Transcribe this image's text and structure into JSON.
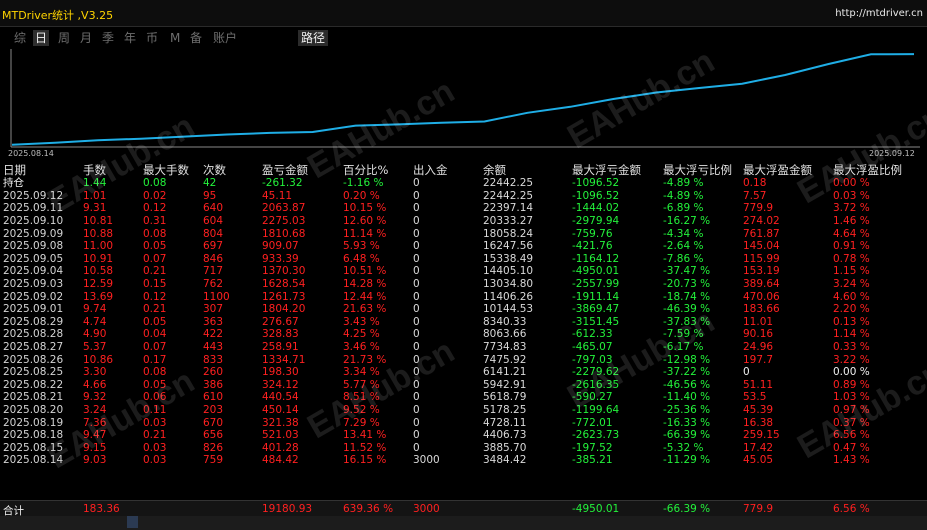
{
  "app": {
    "title": "MTDriver统计 ,V3.25",
    "url": "http://mtdriver.cn"
  },
  "tabs": [
    "综",
    "日",
    "周",
    "月",
    "季",
    "年",
    "币",
    "M",
    "备",
    "账户"
  ],
  "active_tab": "日",
  "path_button": "路径",
  "chart": {
    "start_date": "2025.08.14",
    "end_date": "2025.09.12",
    "line_color": "#1faee6",
    "balance_series": [
      3484.42,
      3885.7,
      4406.73,
      4728.11,
      5178.25,
      5618.79,
      5942.91,
      6141.21,
      7475.92,
      7734.83,
      8063.66,
      8340.33,
      10144.53,
      11406.26,
      13034.8,
      14405.1,
      15338.49,
      16247.56,
      18058.24,
      20333.27,
      22397.14,
      22442.25
    ]
  },
  "columns": [
    "日期",
    "手数",
    "最大手数",
    "次数",
    "盈亏金额",
    "百分比%",
    "出入金",
    "余额",
    "最大浮亏金额",
    "最大浮亏比例",
    "最大浮盈金额",
    "最大浮盈比例"
  ],
  "position_row": {
    "date": "持仓",
    "lots": "1.44",
    "max_lots": "0.08",
    "count": "42",
    "pl": "-261.32",
    "pct": "-1.16 %",
    "io": "0",
    "balance": "22442.25",
    "max_loss": "-1096.52",
    "max_loss_pct": "-4.89 %",
    "max_gain": "0.18",
    "max_gain_pct": "0.00 %"
  },
  "rows": [
    {
      "date": "2025.09.12",
      "lots": "1.01",
      "max_lots": "0.02",
      "count": "95",
      "pl": "45.11",
      "pct": "0.20 %",
      "io": "0",
      "balance": "22442.25",
      "max_loss": "-1096.52",
      "max_loss_pct": "-4.89 %",
      "max_gain": "7.57",
      "max_gain_pct": "0.03 %"
    },
    {
      "date": "2025.09.11",
      "lots": "9.31",
      "max_lots": "0.12",
      "count": "640",
      "pl": "2063.87",
      "pct": "10.15 %",
      "io": "0",
      "balance": "22397.14",
      "max_loss": "-1444.02",
      "max_loss_pct": "-6.89 %",
      "max_gain": "779.9",
      "max_gain_pct": "3.72 %"
    },
    {
      "date": "2025.09.10",
      "lots": "10.81",
      "max_lots": "0.31",
      "count": "604",
      "pl": "2275.03",
      "pct": "12.60 %",
      "io": "0",
      "balance": "20333.27",
      "max_loss": "-2979.94",
      "max_loss_pct": "-16.27 %",
      "max_gain": "274.02",
      "max_gain_pct": "1.46 %"
    },
    {
      "date": "2025.09.09",
      "lots": "10.88",
      "max_lots": "0.08",
      "count": "804",
      "pl": "1810.68",
      "pct": "11.14 %",
      "io": "0",
      "balance": "18058.24",
      "max_loss": "-759.76",
      "max_loss_pct": "-4.34 %",
      "max_gain": "761.87",
      "max_gain_pct": "4.64 %"
    },
    {
      "date": "2025.09.08",
      "lots": "11.00",
      "max_lots": "0.05",
      "count": "697",
      "pl": "909.07",
      "pct": "5.93 %",
      "io": "0",
      "balance": "16247.56",
      "max_loss": "-421.76",
      "max_loss_pct": "-2.64 %",
      "max_gain": "145.04",
      "max_gain_pct": "0.91 %"
    },
    {
      "date": "2025.09.05",
      "lots": "10.91",
      "max_lots": "0.07",
      "count": "846",
      "pl": "933.39",
      "pct": "6.48 %",
      "io": "0",
      "balance": "15338.49",
      "max_loss": "-1164.12",
      "max_loss_pct": "-7.86 %",
      "max_gain": "115.99",
      "max_gain_pct": "0.78 %"
    },
    {
      "date": "2025.09.04",
      "lots": "10.58",
      "max_lots": "0.21",
      "count": "717",
      "pl": "1370.30",
      "pct": "10.51 %",
      "io": "0",
      "balance": "14405.10",
      "max_loss": "-4950.01",
      "max_loss_pct": "-37.47 %",
      "max_gain": "153.19",
      "max_gain_pct": "1.15 %"
    },
    {
      "date": "2025.09.03",
      "lots": "12.59",
      "max_lots": "0.15",
      "count": "762",
      "pl": "1628.54",
      "pct": "14.28 %",
      "io": "0",
      "balance": "13034.80",
      "max_loss": "-2557.99",
      "max_loss_pct": "-20.73 %",
      "max_gain": "389.64",
      "max_gain_pct": "3.24 %"
    },
    {
      "date": "2025.09.02",
      "lots": "13.69",
      "max_lots": "0.12",
      "count": "1100",
      "pl": "1261.73",
      "pct": "12.44 %",
      "io": "0",
      "balance": "11406.26",
      "max_loss": "-1911.14",
      "max_loss_pct": "-18.74 %",
      "max_gain": "470.06",
      "max_gain_pct": "4.60 %"
    },
    {
      "date": "2025.09.01",
      "lots": "9.74",
      "max_lots": "0.21",
      "count": "307",
      "pl": "1804.20",
      "pct": "21.63 %",
      "io": "0",
      "balance": "10144.53",
      "max_loss": "-3869.47",
      "max_loss_pct": "-46.39 %",
      "max_gain": "183.66",
      "max_gain_pct": "2.20 %"
    },
    {
      "date": "2025.08.29",
      "lots": "4.74",
      "max_lots": "0.05",
      "count": "363",
      "pl": "276.67",
      "pct": "3.43 %",
      "io": "0",
      "balance": "8340.33",
      "max_loss": "-3151.45",
      "max_loss_pct": "-37.83 %",
      "max_gain": "11.01",
      "max_gain_pct": "0.13 %"
    },
    {
      "date": "2025.08.28",
      "lots": "4.90",
      "max_lots": "0.04",
      "count": "422",
      "pl": "328.83",
      "pct": "4.25 %",
      "io": "0",
      "balance": "8063.66",
      "max_loss": "-612.33",
      "max_loss_pct": "-7.59 %",
      "max_gain": "90.16",
      "max_gain_pct": "1.14 %"
    },
    {
      "date": "2025.08.27",
      "lots": "5.37",
      "max_lots": "0.07",
      "count": "443",
      "pl": "258.91",
      "pct": "3.46 %",
      "io": "0",
      "balance": "7734.83",
      "max_loss": "-465.07",
      "max_loss_pct": "-6.17 %",
      "max_gain": "24.96",
      "max_gain_pct": "0.33 %"
    },
    {
      "date": "2025.08.26",
      "lots": "10.86",
      "max_lots": "0.17",
      "count": "833",
      "pl": "1334.71",
      "pct": "21.73 %",
      "io": "0",
      "balance": "7475.92",
      "max_loss": "-797.03",
      "max_loss_pct": "-12.98 %",
      "max_gain": "197.7",
      "max_gain_pct": "3.22 %"
    },
    {
      "date": "2025.08.25",
      "lots": "3.30",
      "max_lots": "0.08",
      "count": "260",
      "pl": "198.30",
      "pct": "3.34 %",
      "io": "0",
      "balance": "6141.21",
      "max_loss": "-2279.62",
      "max_loss_pct": "-37.22 %",
      "max_gain": "0",
      "max_gain_pct": "0.00 %"
    },
    {
      "date": "2025.08.22",
      "lots": "4.66",
      "max_lots": "0.05",
      "count": "386",
      "pl": "324.12",
      "pct": "5.77 %",
      "io": "0",
      "balance": "5942.91",
      "max_loss": "-2616.35",
      "max_loss_pct": "-46.56 %",
      "max_gain": "51.11",
      "max_gain_pct": "0.89 %"
    },
    {
      "date": "2025.08.21",
      "lots": "9.32",
      "max_lots": "0.06",
      "count": "610",
      "pl": "440.54",
      "pct": "8.51 %",
      "io": "0",
      "balance": "5618.79",
      "max_loss": "-590.27",
      "max_loss_pct": "-11.40 %",
      "max_gain": "53.5",
      "max_gain_pct": "1.03 %"
    },
    {
      "date": "2025.08.20",
      "lots": "3.24",
      "max_lots": "0.11",
      "count": "203",
      "pl": "450.14",
      "pct": "9.52 %",
      "io": "0",
      "balance": "5178.25",
      "max_loss": "-1199.64",
      "max_loss_pct": "-25.36 %",
      "max_gain": "45.39",
      "max_gain_pct": "0.97 %"
    },
    {
      "date": "2025.08.19",
      "lots": "7.36",
      "max_lots": "0.03",
      "count": "670",
      "pl": "321.38",
      "pct": "7.29 %",
      "io": "0",
      "balance": "4728.11",
      "max_loss": "-772.01",
      "max_loss_pct": "-16.33 %",
      "max_gain": "16.38",
      "max_gain_pct": "0.37 %"
    },
    {
      "date": "2025.08.18",
      "lots": "9.47",
      "max_lots": "0.21",
      "count": "656",
      "pl": "521.03",
      "pct": "13.41 %",
      "io": "0",
      "balance": "4406.73",
      "max_loss": "-2623.73",
      "max_loss_pct": "-66.39 %",
      "max_gain": "259.15",
      "max_gain_pct": "6.56 %"
    },
    {
      "date": "2025.08.15",
      "lots": "9.15",
      "max_lots": "0.03",
      "count": "826",
      "pl": "401.28",
      "pct": "11.52 %",
      "io": "0",
      "balance": "3885.70",
      "max_loss": "-197.52",
      "max_loss_pct": "-5.32 %",
      "max_gain": "17.42",
      "max_gain_pct": "0.47 %"
    },
    {
      "date": "2025.08.14",
      "lots": "9.03",
      "max_lots": "0.03",
      "count": "759",
      "pl": "484.42",
      "pct": "16.15 %",
      "io": "3000",
      "balance": "3484.42",
      "max_loss": "-385.21",
      "max_loss_pct": "-11.29 %",
      "max_gain": "45.05",
      "max_gain_pct": "1.43 %"
    }
  ],
  "totals": {
    "label": "合计",
    "lots": "183.36",
    "pl": "19180.93",
    "pct": "639.36 %",
    "io": "3000",
    "max_loss": "-4950.01",
    "max_loss_pct": "-66.39 %",
    "max_gain": "779.9",
    "max_gain_pct": "6.56 %"
  },
  "watermark": "EAHub.cn",
  "colors": {
    "positive": "#ff2020",
    "negative": "#23f23b",
    "accent": "#ffd400",
    "chart_line": "#1faee6"
  }
}
